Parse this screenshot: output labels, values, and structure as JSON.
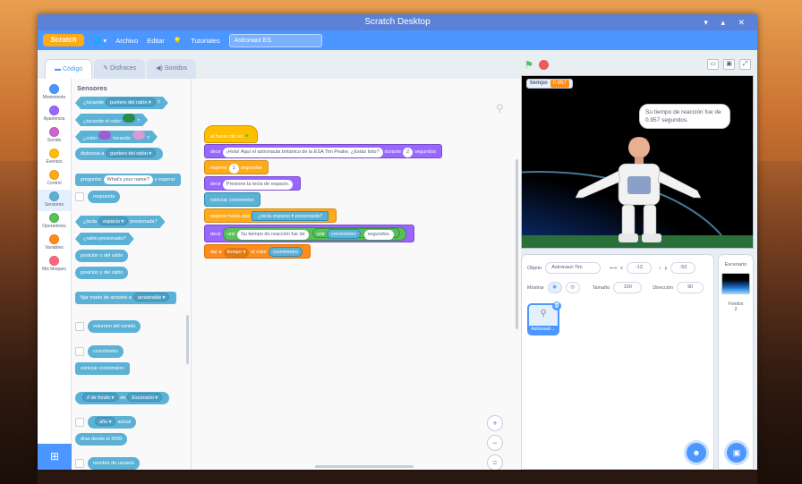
{
  "window": {
    "title": "Scratch Desktop",
    "controls": "▾ ▴ ✕"
  },
  "menubar": {
    "logo": "Scratch",
    "globe": "🌐 ▾",
    "file": "Archivo",
    "edit": "Editar",
    "tutorials": "Tutoriales",
    "project_title": "Astronaut ES"
  },
  "tabs": {
    "code": "Código",
    "costumes": "Disfraces",
    "sounds": "Sonidos"
  },
  "categories": [
    {
      "label": "Movimiento",
      "color": "#4c97ff"
    },
    {
      "label": "Apariencia",
      "color": "#9966ff"
    },
    {
      "label": "Sonido",
      "color": "#cf63cf"
    },
    {
      "label": "Eventos",
      "color": "#ffbf00"
    },
    {
      "label": "Control",
      "color": "#ffab19"
    },
    {
      "label": "Sensores",
      "color": "#5cb1d6"
    },
    {
      "label": "Operadores",
      "color": "#59c059"
    },
    {
      "label": "Variables",
      "color": "#ff8c1a"
    },
    {
      "label": "Mis bloques",
      "color": "#ff6680"
    }
  ],
  "palette": {
    "title": "Sensores",
    "touching": "¿tocando",
    "mouse_pointer": "puntero del ratón ▾",
    "touching_color": "¿tocando el color",
    "color": "¿color",
    "touching2": "tocando",
    "distance": "distancia a",
    "ask": "preguntar",
    "ask_default": "What's your name?",
    "and_wait": "y esperar",
    "answer": "respuesta",
    "key": "¿tecla",
    "space": "espacio ▾",
    "pressed": "presionada?",
    "mouse_down": "¿ratón presionado?",
    "mouse_x": "posición x del ratón",
    "mouse_y": "posición y del ratón",
    "drag_mode": "fijar modo de arrastre a",
    "draggable": "arrastrable ▾",
    "loudness": "volumen del sonido",
    "timer": "cronómetro",
    "reset_timer": "reiniciar cronómetro",
    "backdrop": "# de fondo ▾",
    "of": "de",
    "stage": "Escenario ▾",
    "year": "año ▾",
    "current": "actual",
    "days_since": "días desde el 2000",
    "username": "nombre de usuario"
  },
  "script": {
    "when_flag": "al hacer clic en",
    "say": "decir",
    "say_text": "¡Hola! Aquí el astronauta británico de la ESA Tim Peake. ¿Estás listo?",
    "for": "durante",
    "seconds_val": "2",
    "seconds": "segundos",
    "wait": "esperar",
    "wait_val": "1",
    "wait_seconds": "segundos",
    "say2": "decir",
    "say2_text": "Presione la tecla de espacio.",
    "reset_timer": "reiniciar cronómetro",
    "wait_until": "esperar hasta que",
    "key": "¿tecla",
    "space": "espacio ▾",
    "pressed": "presionada?",
    "say3": "decir",
    "join1": "unir",
    "join1_text": "Su tiempo de reacción fue de",
    "join2": "unir",
    "timer": "cronómetro",
    "secs": "segundos.",
    "set": "dar a",
    "var": "tiempo ▾",
    "value": "el valor",
    "timer2": "cronómetro"
  },
  "zoom": {
    "in": "+",
    "out": "−",
    "reset": "="
  },
  "stage": {
    "monitor_label": "tiempo",
    "monitor_value": "0.957",
    "bubble": "Su tiempo de reacción fue de 0.957 segundos."
  },
  "sprite_info": {
    "sprite_label": "Objeto",
    "sprite_name": "Astronaut-Tim",
    "x_label": "x",
    "x": "-13",
    "y_label": "y",
    "y": "-53",
    "show_label": "Mostrar",
    "size_label": "Tamaño",
    "size": "100",
    "direction_label": "Dirección",
    "direction": "90",
    "tile_name": "Astronaut-..."
  },
  "stage_pane": {
    "title": "Escenario",
    "backdrops_label": "Fondos",
    "backdrops": "2"
  },
  "colors": {
    "accent": "#4c97ff"
  }
}
